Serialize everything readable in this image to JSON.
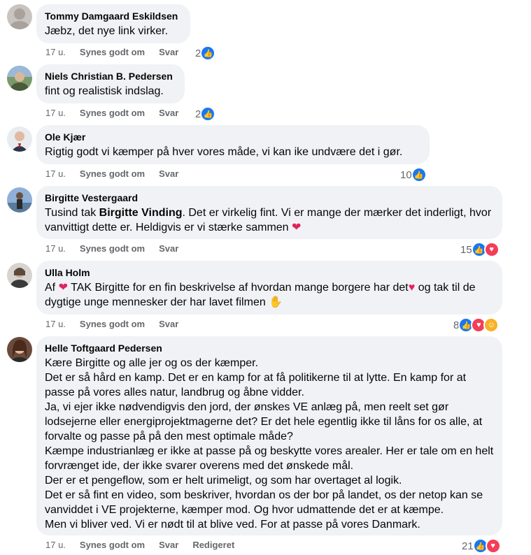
{
  "colors": {
    "like": "#1877f2",
    "love": "#f33e58",
    "care": "#f7b125",
    "bubble": "#f0f2f5",
    "meta": "#65676b"
  },
  "comments": [
    {
      "author": "Tommy Damgaard Eskildsen",
      "text": "Jæbz, det nye link virker.",
      "time": "17 u.",
      "like": "Synes godt om",
      "reply": "Svar",
      "count": "2",
      "reactions": [
        "like"
      ]
    },
    {
      "author": "Niels Christian B. Pedersen",
      "text": "fint og realistisk indslag.",
      "time": "17 u.",
      "like": "Synes godt om",
      "reply": "Svar",
      "count": "2",
      "reactions": [
        "like"
      ]
    },
    {
      "author": "Ole Kjær",
      "text": "Rigtig godt vi kæmper på hver vores måde, vi kan ike undvære det i gør.",
      "time": "17 u.",
      "like": "Synes godt om",
      "reply": "Svar",
      "count": "10",
      "reactions": [
        "like"
      ]
    },
    {
      "author": "Birgitte Vestergaard",
      "text_pre": "Tusind tak ",
      "mention": "Birgitte Vinding",
      "text_post": ". Det er virkelig fint. Vi er mange der mærker det inderligt, hvor vanvittigt dette er. Heldigvis er vi stærke sammen",
      "time": "17 u.",
      "like": "Synes godt om",
      "reply": "Svar",
      "count": "15",
      "reactions": [
        "like",
        "love"
      ]
    },
    {
      "author": "Ulla Holm",
      "text_a": "Af ",
      "text_b": " TAK Birgitte for en fin beskrivelse af hvordan mange borgere har det",
      "text_c": " og tak til de dygtige unge mennesker der har lavet filmen",
      "time": "17 u.",
      "like": "Synes godt om",
      "reply": "Svar",
      "count": "8",
      "reactions": [
        "like",
        "love",
        "care"
      ]
    },
    {
      "author": "Helle Toftgaard Pedersen",
      "text": "Kære Birgitte og alle jer og os der kæmper.\nDet er så hård en kamp. Det er en kamp for at få politikerne til at lytte. En kamp for at passe på vores alles natur, landbrug og åbne vidder.\nJa, vi ejer ikke nødvendigvis den jord, der ønskes VE anlæg på, men reelt set gør lodsejerne eller energiprojektmagerne det? Er det hele egentlig ikke til låns for os alle, at forvalte og passe på på den mest optimale måde?\nKæmpe industrianlæg er ikke at passe på og beskytte vores arealer. Her er tale om en helt forvrænget ide, der ikke svarer overens med det ønskede mål.\nDer er et pengeflow, som er helt urimeligt, og som har overtaget al logik.\nDet er så fint en video, som beskriver, hvordan os der bor på landet, os der netop kan se vanviddet i VE projekterne, kæmper mod. Og hvor udmattende det er at kæmpe.\nMen vi bliver ved. Vi er nødt til at blive ved. For at passe på vores Danmark.",
      "time": "17 u.",
      "like": "Synes godt om",
      "reply": "Svar",
      "edited": "Redigeret",
      "count": "21",
      "reactions": [
        "like",
        "love"
      ]
    }
  ]
}
